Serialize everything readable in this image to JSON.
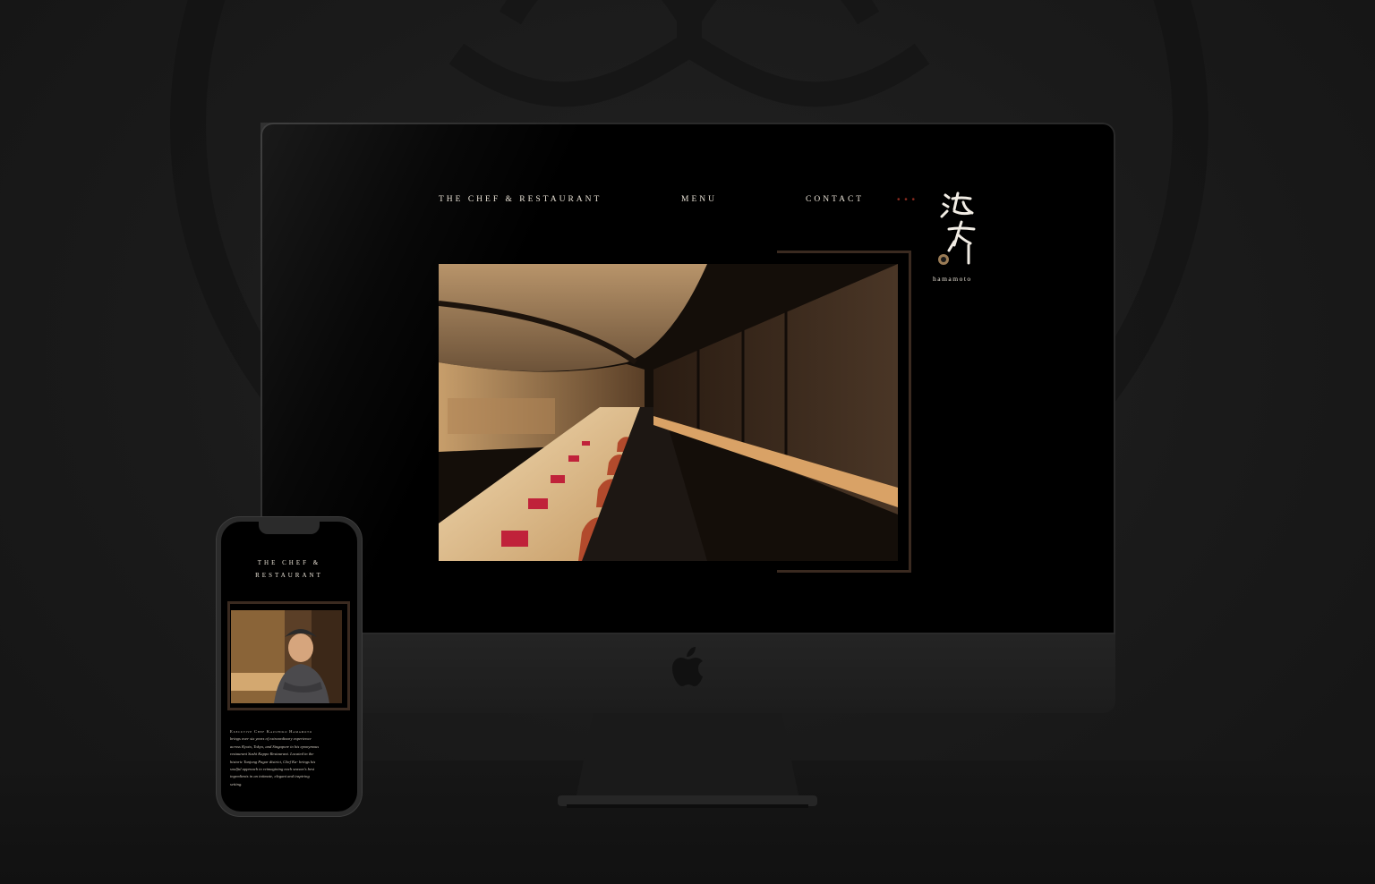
{
  "desktop": {
    "nav": {
      "chef_restaurant": "THE CHEF & RESTAURANT",
      "menu": "MENU",
      "contact": "CONTACT",
      "dots": "• • •"
    },
    "brand": {
      "name": "hamamoto"
    }
  },
  "mobile": {
    "title_line1": "THE CHEF &",
    "title_line2": "RESTAURANT",
    "bio_heading": "Executive Chef Kazuhiko Hamamoto",
    "bio_lines": [
      "brings over six years of extraordinary experience",
      "across Kyoto, Tokyo, and Singapore to his eponymous",
      "restaurant Sushi Kappo Restaurant. Located in the",
      "historic Tanjong Pagar district, Chef Ka- brings his",
      "soulful approach to reimagining each season's best",
      "ingredients in an intimate, elegant and inspiring",
      "setting."
    ]
  },
  "colors": {
    "accent": "#8a2b1f",
    "frame": "#3a2a20",
    "text": "#e9e2d6"
  }
}
